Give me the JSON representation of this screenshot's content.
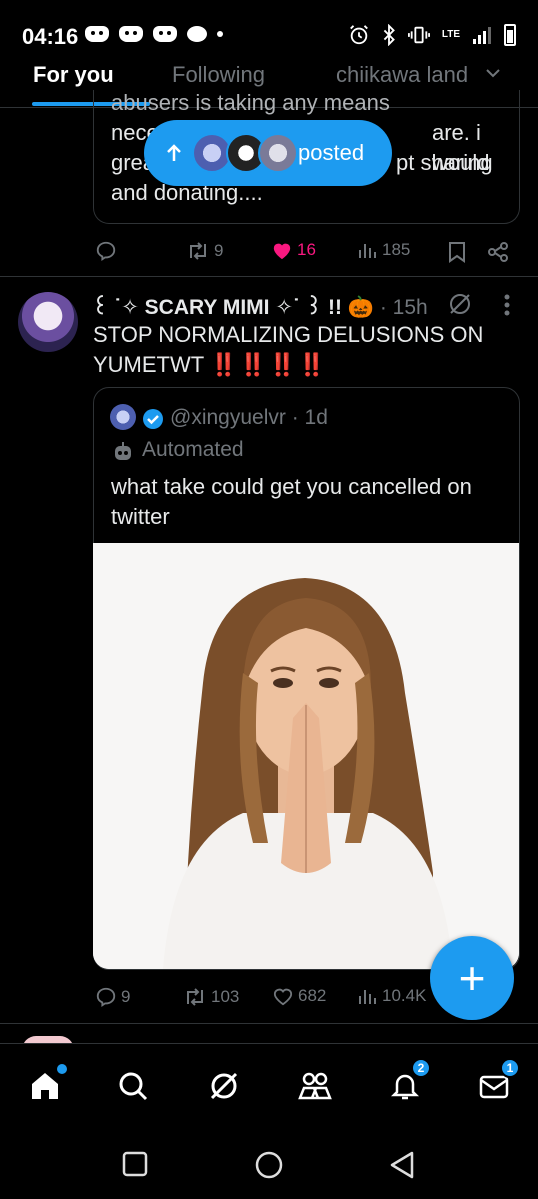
{
  "status_bar": {
    "time": "04:16",
    "network": "LTE"
  },
  "tabs": [
    {
      "label": "For you",
      "active": true
    },
    {
      "label": "Following",
      "active": false
    },
    {
      "label": "chiikawa land",
      "active": false
    }
  ],
  "prev_tweet": {
    "quote_text_partial": [
      "abusers is taking any means",
      "nece",
      "are. i would",
      "grea",
      "pt sharing",
      "and donating...."
    ],
    "actions": {
      "replies": "",
      "reposts": "9",
      "likes": "16",
      "views": "185"
    }
  },
  "posted_pill": {
    "label": "posted",
    "icon": "arrow-up-icon"
  },
  "tweet": {
    "display_name": "꒰ ˙✧ SCARY MIMI ✧˙ ꒱ !! 🎃",
    "time": "· 15h",
    "text_line1": "STOP NORMALIZING DELUSIONS ON",
    "text_line2": "YUMETWT",
    "text_emphasis": "‼️‼️‼️‼️",
    "quote": {
      "handle": "@xingyuelvr",
      "time": "· 1d",
      "automated_label": "Automated",
      "text_line1": "what take could get you cancelled on",
      "text_line2": "twitter"
    },
    "actions": {
      "replies": "9",
      "reposts": "103",
      "likes": "682",
      "views": "10.4K"
    }
  },
  "fab_label": "+",
  "nav": {
    "notifications_badge": "2",
    "messages_badge": "1"
  },
  "colors": {
    "accent": "#1d9bf0",
    "like": "#f91880",
    "muted": "#71767b",
    "text": "#e7e9ea"
  }
}
